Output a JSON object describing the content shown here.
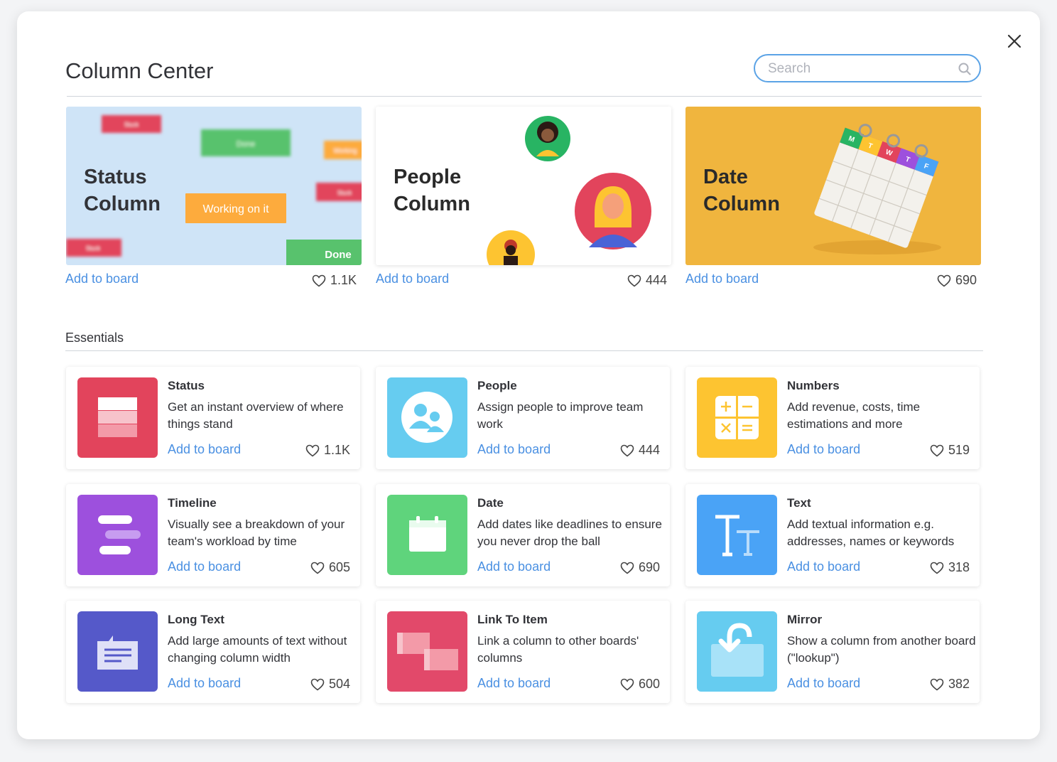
{
  "modal": {
    "title": "Column Center",
    "search_placeholder": "Search"
  },
  "featured": [
    {
      "title": "Status Column",
      "add_label": "Add to board",
      "likes": "1.1K",
      "chips": [
        "Stuck",
        "Done",
        "Working",
        "Working on it",
        "Stuck",
        "Stuck",
        "Done"
      ]
    },
    {
      "title": "People Column",
      "add_label": "Add to board",
      "likes": "444"
    },
    {
      "title": "Date Column",
      "add_label": "Add to board",
      "likes": "690",
      "calendar_days": [
        "M",
        "T",
        "W",
        "T",
        "F"
      ]
    }
  ],
  "section": {
    "label": "Essentials"
  },
  "cards": [
    {
      "name": "Status",
      "desc": "Get an instant overview of where things stand",
      "add_label": "Add to board",
      "likes": "1.1K",
      "color": "#e2445c",
      "icon": "status-icon"
    },
    {
      "name": "People",
      "desc": "Assign people to improve team work",
      "add_label": "Add to board",
      "likes": "444",
      "color": "#66ccf0",
      "icon": "people-icon"
    },
    {
      "name": "Numbers",
      "desc": "Add revenue, costs, time estimations and more",
      "add_label": "Add to board",
      "likes": "519",
      "color": "#fdc431",
      "icon": "numbers-icon"
    },
    {
      "name": "Timeline",
      "desc": "Visually see a breakdown of your team's workload by time",
      "add_label": "Add to board",
      "likes": "605",
      "color": "#9d50dd",
      "icon": "timeline-icon"
    },
    {
      "name": "Date",
      "desc": "Add dates like deadlines to ensure you never drop the ball",
      "add_label": "Add to board",
      "likes": "690",
      "color": "#5fd47c",
      "icon": "calendar-icon"
    },
    {
      "name": "Text",
      "desc": "Add textual information e.g. addresses, names or keywords",
      "add_label": "Add to board",
      "likes": "318",
      "color": "#4aa3f6",
      "icon": "text-icon"
    },
    {
      "name": "Long Text",
      "desc": "Add large amounts of text without changing column width",
      "add_label": "Add to board",
      "likes": "504",
      "color": "#5559c9",
      "icon": "long-text-icon"
    },
    {
      "name": "Link To Item",
      "desc": "Link a column to other boards' columns",
      "add_label": "Add to board",
      "likes": "600",
      "color": "#e2496a",
      "icon": "link-icon"
    },
    {
      "name": "Mirror",
      "desc": "Show a column from another board (\"lookup\")",
      "add_label": "Add to board",
      "likes": "382",
      "color": "#66ccf0",
      "icon": "mirror-icon"
    }
  ]
}
